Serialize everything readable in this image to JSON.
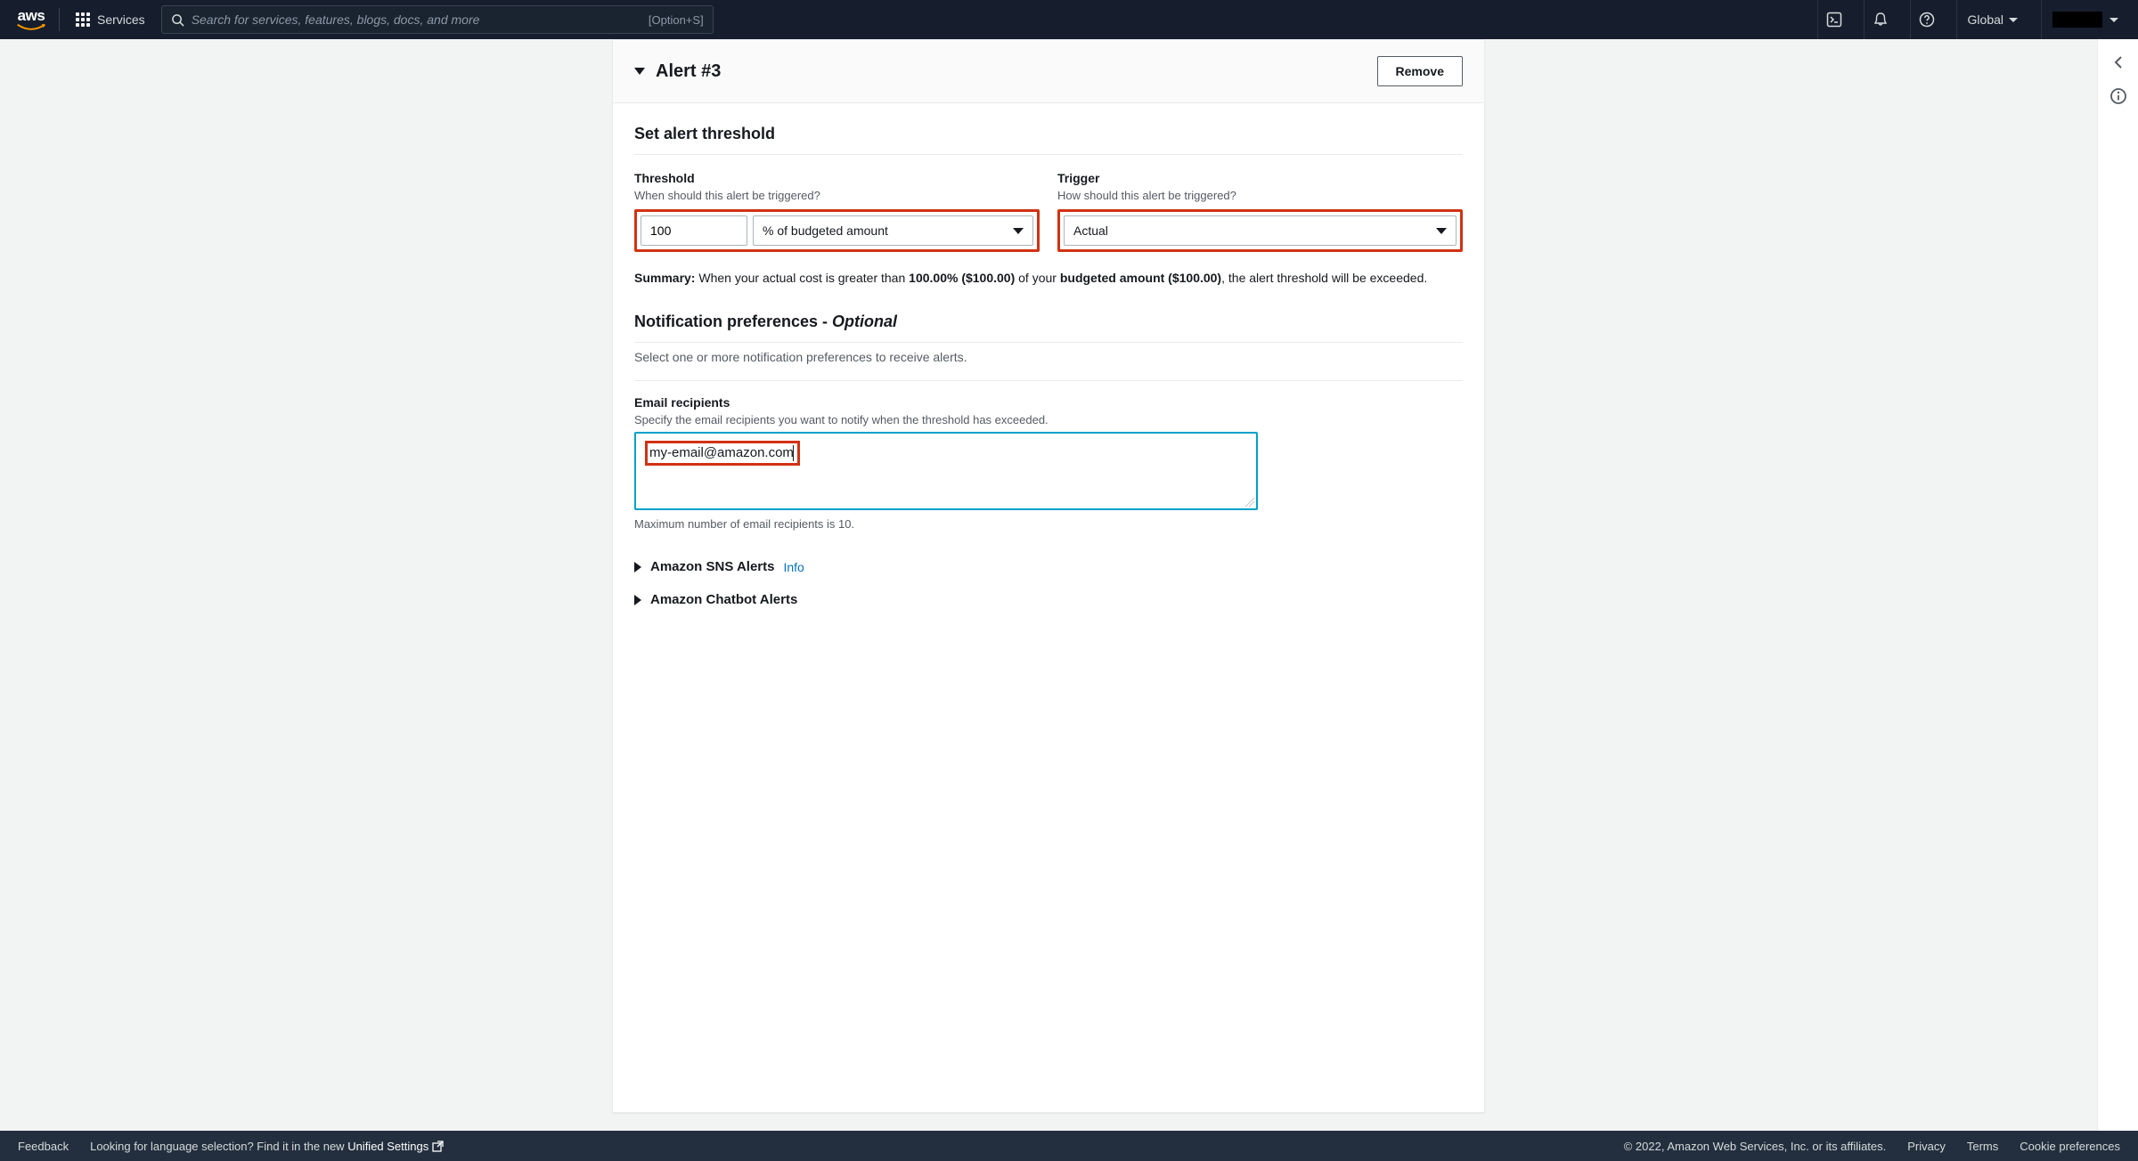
{
  "nav": {
    "services_label": "Services",
    "search_placeholder": "Search for services, features, blogs, docs, and more",
    "search_hint": "[Option+S]",
    "region_label": "Global"
  },
  "panel": {
    "title": "Alert #3",
    "remove_label": "Remove"
  },
  "threshold_section": {
    "title": "Set alert threshold",
    "threshold_label": "Threshold",
    "threshold_hint": "When should this alert be triggered?",
    "threshold_value": "100",
    "threshold_unit": "% of budgeted amount",
    "trigger_label": "Trigger",
    "trigger_hint": "How should this alert be triggered?",
    "trigger_value": "Actual",
    "summary_prefix": "Summary:",
    "summary_part1": " When your actual cost is greater than ",
    "summary_pct": "100.00% ($100.00)",
    "summary_part2": " of your ",
    "summary_budget": "budgeted amount ($100.00)",
    "summary_part3": ", the alert threshold will be exceeded."
  },
  "notify_section": {
    "title_main": "Notification preferences - ",
    "title_optional": "Optional",
    "desc": "Select one or more notification preferences to receive alerts.",
    "email_label": "Email recipients",
    "email_hint": "Specify the email recipients you want to notify when the threshold has exceeded.",
    "email_value": "my-email@amazon.com",
    "email_max": "Maximum number of email recipients is 10.",
    "sns_label": "Amazon SNS Alerts",
    "sns_info": "Info",
    "chatbot_label": "Amazon Chatbot Alerts"
  },
  "footer": {
    "feedback": "Feedback",
    "lang_prompt": "Looking for language selection? Find it in the new ",
    "unified": "Unified Settings",
    "copyright": "© 2022, Amazon Web Services, Inc. or its affiliates.",
    "privacy": "Privacy",
    "terms": "Terms",
    "cookies": "Cookie preferences"
  }
}
